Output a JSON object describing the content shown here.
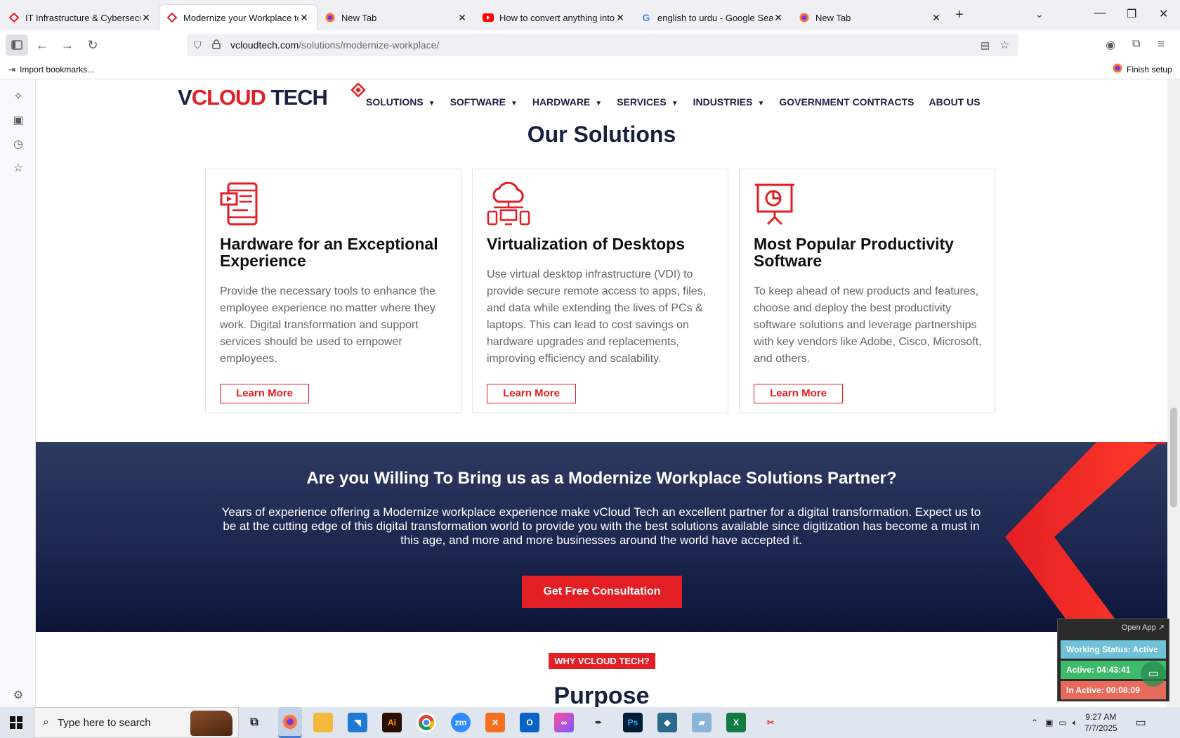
{
  "browser": {
    "tabs": [
      {
        "label": "IT Infrastructure & Cybersecurity",
        "icon": "vcloud-favicon",
        "active": false
      },
      {
        "label": "Modernize your Workplace to E",
        "icon": "vcloud-favicon",
        "active": true
      },
      {
        "label": "New Tab",
        "icon": "firefox-icon",
        "active": false
      },
      {
        "label": "How to convert anything into E",
        "icon": "youtube-icon",
        "active": false
      },
      {
        "label": "english to urdu - Google Search",
        "icon": "google-icon",
        "active": false
      },
      {
        "label": "New Tab",
        "icon": "firefox-icon",
        "active": false
      }
    ],
    "url_host": "vcloudtech.com",
    "url_path": "/solutions/modernize-workplace/",
    "import_bookmarks": "Import bookmarks...",
    "finish_setup": "Finish setup"
  },
  "site": {
    "logo_part1": "V",
    "logo_part2": "CLOUD",
    "logo_part3": " TECH",
    "menu": [
      "SOLUTIONS",
      "SOFTWARE",
      "HARDWARE",
      "SERVICES",
      "INDUSTRIES",
      "GOVERNMENT CONTRACTS",
      "ABOUT US"
    ],
    "solutions_title": "Our Solutions",
    "cards": [
      {
        "title": "Hardware for an Exceptional Experience",
        "body": "Provide the necessary tools to enhance the employee experience no matter where they work. Digital transformation and support services should be used to empower employees.",
        "button": "Learn More"
      },
      {
        "title": "Virtualization of Desktops",
        "body": "Use virtual desktop infrastructure (VDI) to provide secure remote access to apps, files, and data while extending the lives of PCs & laptops. This can lead to cost savings on hardware upgrades and replacements, improving efficiency and scalability.",
        "button": "Learn More"
      },
      {
        "title": "Most Popular Productivity Software",
        "body": "To keep ahead of new products and features, choose and deploy the best productivity software solutions and leverage partnerships with key vendors like Adobe, Cisco, Microsoft, and others.",
        "button": "Learn More"
      }
    ],
    "partner_heading": "Are you Willing To Bring us as a Modernize Workplace Solutions Partner?",
    "partner_text": "Years of experience offering a Modernize workplace experience make vCloud Tech an excellent partner for a digital transformation. Expect us to be at the cutting edge of this digital transformation world to provide you with the best solutions available since digitization has become a must in this age, and more and more businesses around the world have accepted it.",
    "cta": "Get Free Consultation",
    "badge": "WHY VCLOUD TECH?",
    "purpose": "Purpose"
  },
  "widget": {
    "open_app": "Open App",
    "working_status": "Working Status: Active",
    "active": "Active: 04:43:41",
    "inactive": "In Active: 00:08:09"
  },
  "taskbar": {
    "search_placeholder": "Type here to search",
    "time": "9:27 AM",
    "date": "7/7/2025"
  },
  "colors": {
    "brand_red": "#e31e24",
    "brand_navy": "#1c2244"
  }
}
